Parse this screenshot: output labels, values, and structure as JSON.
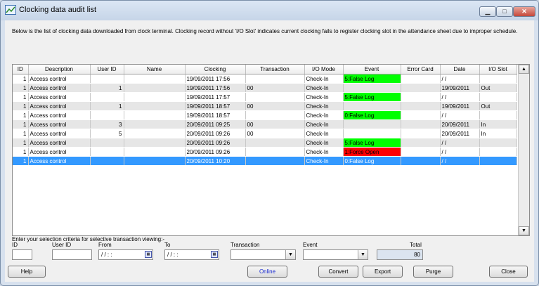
{
  "window": {
    "title": "Clocking data audit list",
    "minimize_symbol": "▁",
    "maximize_symbol": "□",
    "close_symbol": "✕"
  },
  "description": "Below is the list of clocking data downloaded from clock terminal. Clocking record without 'I/O Slot' indicates current clocking fails to register clocking slot in the attendance sheet due to improper schedule.",
  "table": {
    "columns": [
      "ID",
      "Description",
      "User ID",
      "Name",
      "Clocking",
      "Transaction",
      "I/O Mode",
      "Event",
      "Error Card",
      "Date",
      "I/O Slot"
    ],
    "rows": [
      {
        "id": "1",
        "description": "Access control",
        "user_id": "",
        "name": "",
        "clocking": "19/09/2011 17:56",
        "transaction": "",
        "io_mode": "Check-In",
        "event": "5:False Log",
        "event_color": "green",
        "error_card": "",
        "date": "/ /",
        "io_slot": ""
      },
      {
        "id": "1",
        "description": "Access control",
        "user_id": "1",
        "name": "",
        "clocking": "19/09/2011 17:56",
        "transaction": "00",
        "io_mode": "Check-In",
        "event": "",
        "event_color": "",
        "error_card": "",
        "date": "19/09/2011",
        "io_slot": "Out"
      },
      {
        "id": "1",
        "description": "Access control",
        "user_id": "",
        "name": "",
        "clocking": "19/09/2011 17:57",
        "transaction": "",
        "io_mode": "Check-In",
        "event": "5:False Log",
        "event_color": "green",
        "error_card": "",
        "date": "/ /",
        "io_slot": ""
      },
      {
        "id": "1",
        "description": "Access control",
        "user_id": "1",
        "name": "",
        "clocking": "19/09/2011 18:57",
        "transaction": "00",
        "io_mode": "Check-In",
        "event": "",
        "event_color": "",
        "error_card": "",
        "date": "19/09/2011",
        "io_slot": "Out"
      },
      {
        "id": "1",
        "description": "Access control",
        "user_id": "",
        "name": "",
        "clocking": "19/09/2011 18:57",
        "transaction": "",
        "io_mode": "Check-In",
        "event": "0:False Log",
        "event_color": "green",
        "error_card": "",
        "date": "/ /",
        "io_slot": ""
      },
      {
        "id": "1",
        "description": "Access control",
        "user_id": "3",
        "name": "",
        "clocking": "20/09/2011 09:25",
        "transaction": "00",
        "io_mode": "Check-In",
        "event": "",
        "event_color": "",
        "error_card": "",
        "date": "20/09/2011",
        "io_slot": "In"
      },
      {
        "id": "1",
        "description": "Access control",
        "user_id": "5",
        "name": "",
        "clocking": "20/09/2011 09:26",
        "transaction": "00",
        "io_mode": "Check-In",
        "event": "",
        "event_color": "",
        "error_card": "",
        "date": "20/09/2011",
        "io_slot": "In"
      },
      {
        "id": "1",
        "description": "Access control",
        "user_id": "",
        "name": "",
        "clocking": "20/09/2011 09:26",
        "transaction": "",
        "io_mode": "Check-In",
        "event": "5:False Log",
        "event_color": "green",
        "error_card": "",
        "date": "/ /",
        "io_slot": ""
      },
      {
        "id": "1",
        "description": "Access control",
        "user_id": "",
        "name": "",
        "clocking": "20/09/2011 09:26",
        "transaction": "",
        "io_mode": "Check-In",
        "event": "1:Force Open",
        "event_color": "red",
        "error_card": "",
        "date": "/ /",
        "io_slot": ""
      },
      {
        "id": "1",
        "description": "Access control",
        "user_id": "",
        "name": "",
        "clocking": "20/09/2011 10:20",
        "transaction": "",
        "io_mode": "Check-In",
        "event": "0:False Log",
        "event_color": "green",
        "error_card": "",
        "date": "/ /",
        "io_slot": "",
        "selected": true
      }
    ]
  },
  "filters": {
    "heading": "Enter your selection criteria for selective transaction viewing:-",
    "id_label": "ID",
    "user_id_label": "User ID",
    "from_label": "From",
    "to_label": "To",
    "transaction_label": "Transaction",
    "event_label": "Event",
    "total_label": "Total",
    "id_value": "",
    "user_id_value": "",
    "from_value": "/ /   : :",
    "to_value": "/ /   : :",
    "transaction_value": "",
    "event_value": "",
    "total_value": "80"
  },
  "buttons": {
    "help": "Help",
    "online": "Online",
    "convert": "Convert",
    "export": "Export",
    "purge": "Purge",
    "close": "Close"
  },
  "colors": {
    "event_green": "#00ff00",
    "event_red": "#ff0000",
    "selection": "#3399ff"
  }
}
